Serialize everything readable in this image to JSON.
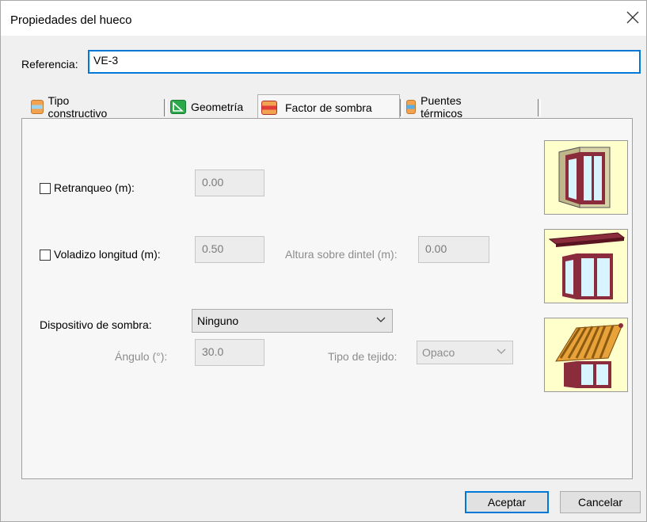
{
  "window": {
    "title": "Propiedades del hueco"
  },
  "reference": {
    "label": "Referencia:",
    "value": "VE-3"
  },
  "tabs": [
    {
      "label": "Tipo constructivo",
      "icon": "construction-type-icon"
    },
    {
      "label": "Geometría",
      "icon": "geometry-icon"
    },
    {
      "label": "Factor de sombra",
      "icon": "shade-factor-icon",
      "active": true
    },
    {
      "label": "Puentes térmicos",
      "icon": "thermal-bridges-icon"
    }
  ],
  "form": {
    "retranqueo": {
      "label": "Retranqueo (m):",
      "value": "0.00",
      "checked": false
    },
    "voladizo": {
      "label": "Voladizo longitud (m):",
      "value": "0.50",
      "checked": false
    },
    "altura": {
      "label": "Altura sobre dintel (m):",
      "value": "0.00"
    },
    "dispositivo": {
      "label": "Dispositivo de sombra:",
      "value": "Ninguno"
    },
    "angulo": {
      "label": "Ángulo (°):",
      "value": "30.0"
    },
    "tejido": {
      "label": "Tipo de tejido:",
      "value": "Opaco"
    }
  },
  "buttons": {
    "accept": "Aceptar",
    "cancel": "Cancelar"
  },
  "colors": {
    "accent": "#0078d7",
    "preview_bg": "#ffffcc",
    "frame": "#8b2c3c"
  }
}
